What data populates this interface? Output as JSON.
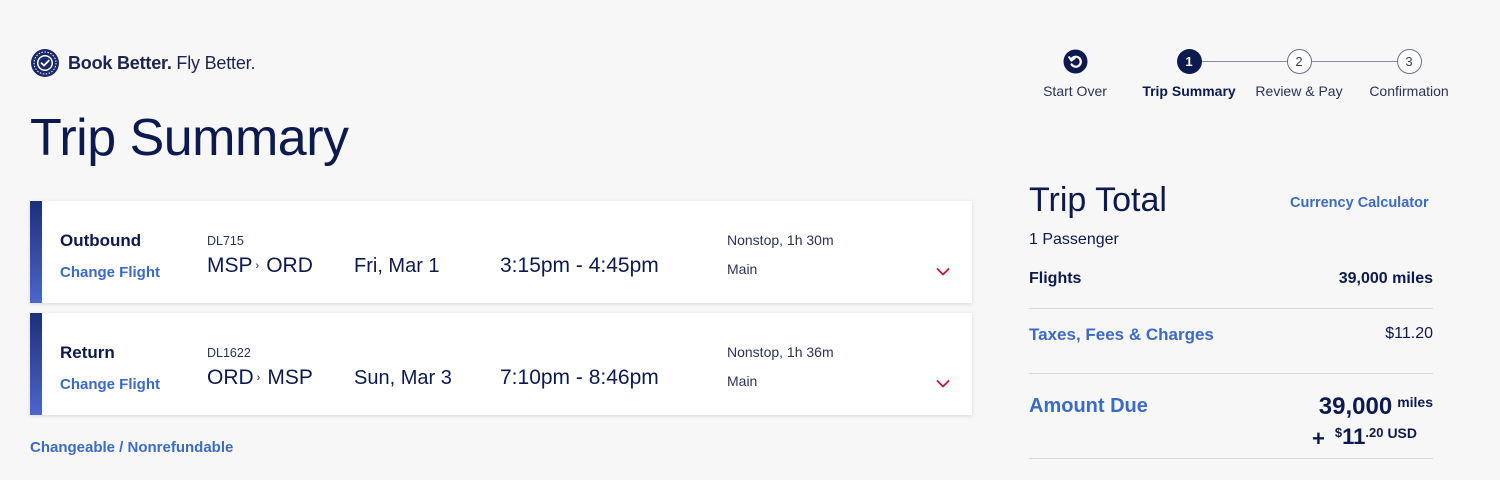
{
  "brand": {
    "tagline_bold": "Book Better.",
    "tagline_rest": " Fly Better.",
    "accent": "#3b6bc6",
    "navy": "#0c1a4f",
    "chevron_color": "#c01933"
  },
  "page_title": "Trip Summary",
  "stepper": {
    "start_over": "Start Over",
    "steps": [
      {
        "number": "1",
        "label": "Trip Summary",
        "state": "active"
      },
      {
        "number": "2",
        "label": "Review & Pay",
        "state": "todo"
      },
      {
        "number": "3",
        "label": "Confirmation",
        "state": "todo"
      }
    ]
  },
  "flights": [
    {
      "leg": "Outbound",
      "change_label": "Change Flight",
      "flight_number": "DL715",
      "origin": "MSP",
      "arrow": "›",
      "destination": "ORD",
      "date": "Fri, Mar 1",
      "times": "3:15pm - 4:45pm",
      "stops": "Nonstop, 1h 30m",
      "cabin": "Main",
      "icon": "chevron-down-icon"
    },
    {
      "leg": "Return",
      "change_label": "Change Flight",
      "flight_number": "DL1622",
      "origin": "ORD",
      "arrow": "›",
      "destination": "MSP",
      "date": "Sun, Mar 3",
      "times": "7:10pm - 8:46pm",
      "stops": "Nonstop, 1h 36m",
      "cabin": "Main",
      "icon": "chevron-down-icon"
    }
  ],
  "fare_rules": "Changeable / Nonrefundable",
  "trip_total": {
    "title": "Trip Total",
    "currency_calculator": "Currency Calculator",
    "passengers": "1 Passenger",
    "flights_label": "Flights",
    "flights_value": "39,000 miles",
    "taxes_label": "Taxes, Fees & Charges",
    "taxes_value": "$11.20",
    "amount_due_label": "Amount Due",
    "amount_due_miles": "39,000",
    "amount_due_miles_unit": "miles",
    "plus": "+",
    "amount_due_currency_symbol": "$",
    "amount_due_dollars": "11",
    "amount_due_cents": ".20",
    "amount_due_currency_code": "USD"
  }
}
